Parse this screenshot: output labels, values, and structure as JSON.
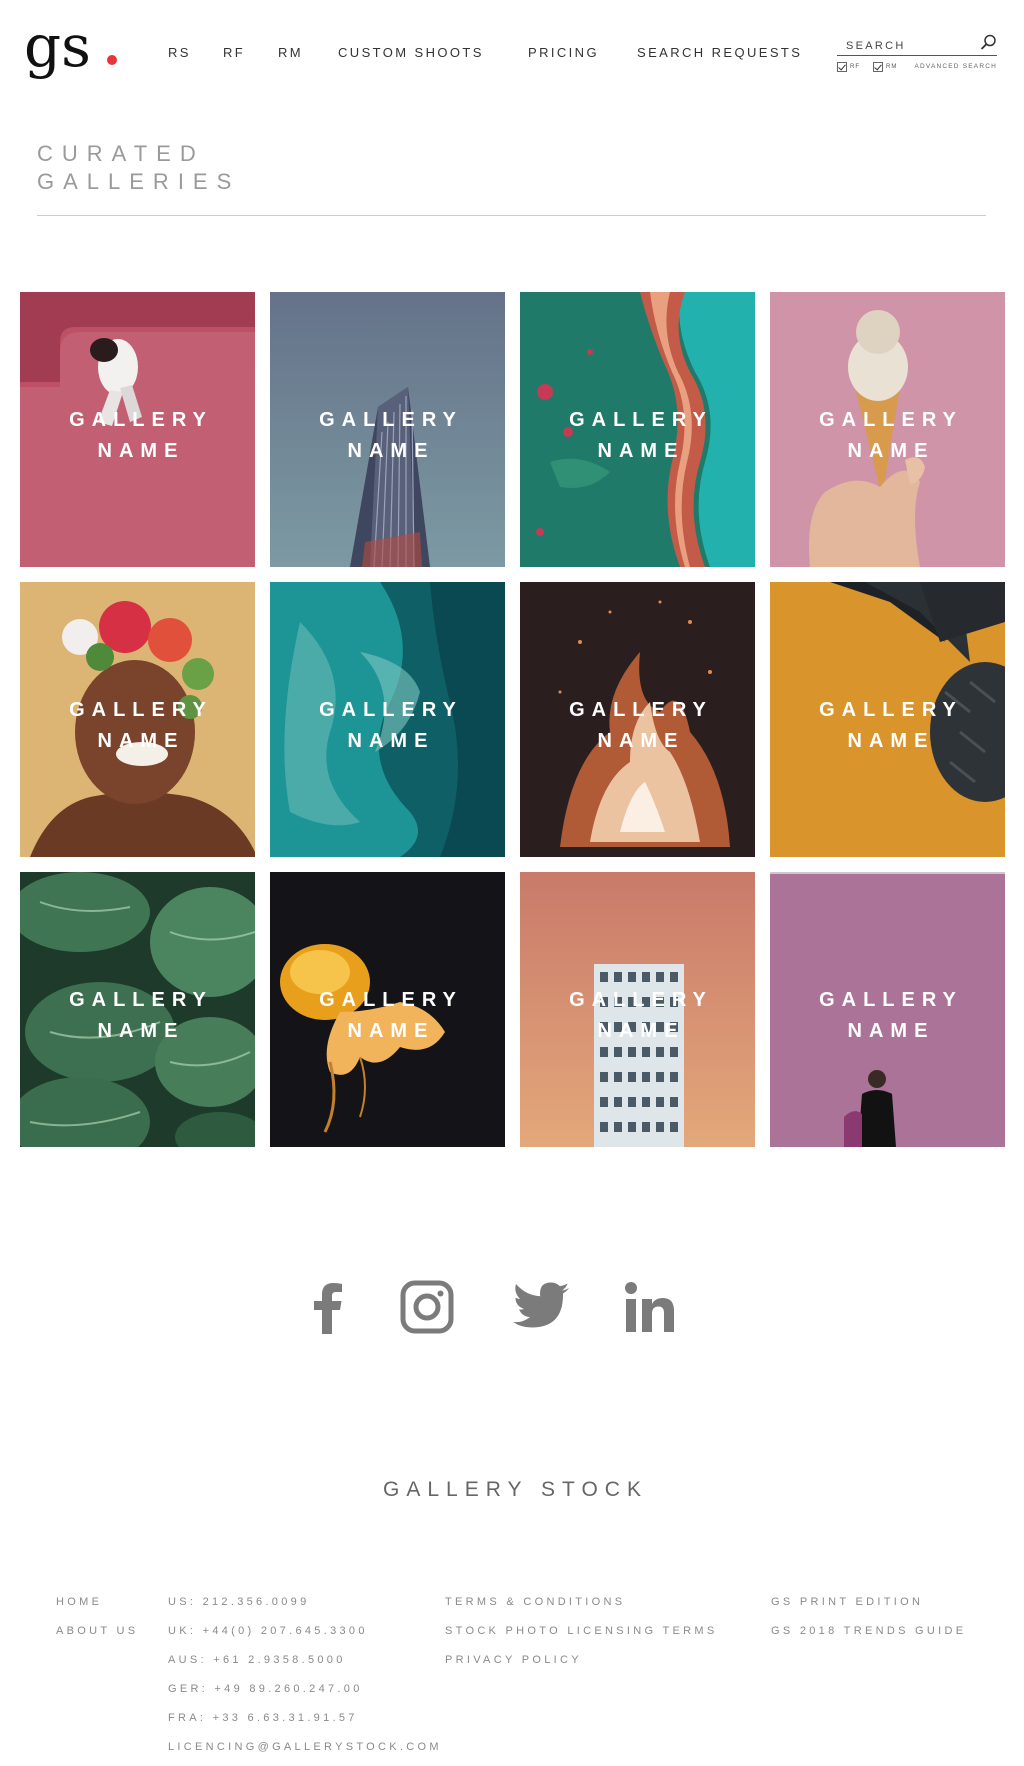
{
  "header": {
    "logo_text": "gs.",
    "nav": [
      "RS",
      "RF",
      "RM",
      "CUSTOM SHOOTS",
      "PRICING",
      "SEARCH REQUESTS"
    ],
    "search": {
      "placeholder": "SEARCH",
      "value": "",
      "options": [
        {
          "label": "RF",
          "checked": true
        },
        {
          "label": "RM",
          "checked": true
        }
      ],
      "advanced_label": "ADVANCED SEARCH"
    }
  },
  "page": {
    "title_lines": [
      "CURATED",
      "GALLERIES"
    ]
  },
  "galleries": [
    {
      "line1": "GALLERY",
      "line2": "NAME",
      "image": "person curled on pink surface",
      "color": "#b64a5d"
    },
    {
      "line1": "GALLERY",
      "line2": "NAME",
      "image": "skyscraper against blue-grey sky",
      "color": "#6a7a93"
    },
    {
      "line1": "GALLERY",
      "line2": "NAME",
      "image": "teal and red rusted texture",
      "color": "#1e8a78"
    },
    {
      "line1": "GALLERY",
      "line2": "NAME",
      "image": "hand holding ice cream cone on pink",
      "color": "#cf92a6"
    },
    {
      "line1": "GALLERY",
      "line2": "NAME",
      "image": "smiling woman with flower crown",
      "color": "#d9b36e"
    },
    {
      "line1": "GALLERY",
      "line2": "NAME",
      "image": "aerial turquoise water",
      "color": "#137a7d"
    },
    {
      "line1": "GALLERY",
      "line2": "NAME",
      "image": "bonfire flames on dark",
      "color": "#2b2020"
    },
    {
      "line1": "GALLERY",
      "line2": "NAME",
      "image": "pineapple on orange",
      "color": "#d8962a"
    },
    {
      "line1": "GALLERY",
      "line2": "NAME",
      "image": "striped green leaves",
      "color": "#2f5b43"
    },
    {
      "line1": "GALLERY",
      "line2": "NAME",
      "image": "orange jellyfish on black",
      "color": "#141417"
    },
    {
      "line1": "GALLERY",
      "line2": "NAME",
      "image": "white building on peach sky",
      "color": "#d48a6c"
    },
    {
      "line1": "GALLERY",
      "line2": "NAME",
      "image": "man in black on purple wall",
      "color": "#a97294"
    }
  ],
  "social": [
    "facebook-icon",
    "instagram-icon",
    "twitter-icon",
    "linkedin-icon"
  ],
  "footer": {
    "brand": "GALLERY STOCK",
    "col1": [
      "HOME",
      "ABOUT US"
    ],
    "col2": [
      "US: 212.356.0099",
      "UK: +44(0) 207.645.3300",
      "AUS: +61 2.9358.5000",
      "GER: +49 89.260.247.00",
      "FRA: +33 6.63.31.91.57",
      "LICENCING@GALLERYSTOCK.COM"
    ],
    "col3": [
      "TERMS & CONDITIONS",
      "STOCK PHOTO LICENSING TERMS",
      "PRIVACY POLICY"
    ],
    "col4": [
      "GS PRINT EDITION",
      "GS 2018 TRENDS GUIDE"
    ]
  }
}
